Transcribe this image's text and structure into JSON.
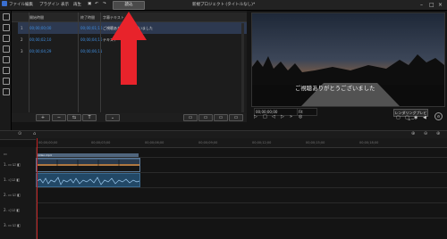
{
  "menu": [
    "ファイル",
    "編集",
    "プラグイン",
    "表示",
    "再生"
  ],
  "import_label": "読込",
  "window_title": "新規プロジェクト (タイトルなし)*",
  "subtitles": {
    "headers": [
      "開始時間",
      "終了時間",
      "字幕テキスト"
    ],
    "rows": [
      {
        "index": "1",
        "start": "00;00;00;00",
        "end": "00;00;01;10",
        "text": "ご視聴ありがとうございました"
      },
      {
        "index": "2",
        "start": "00;00;02;10",
        "end": "00;00;04;16",
        "text": "テキスト"
      },
      {
        "index": "3",
        "start": "00;00;04;29",
        "end": "00;00;06;11",
        "text": ""
      }
    ]
  },
  "preview": {
    "caption": "ご視聴ありがとうございました",
    "timecode": "00;00;00;00",
    "fit": "Fit",
    "render_label": "レンダリングプレビュー"
  },
  "timeline": {
    "ticks": [
      "00;00;00;00",
      "00;00;03;00",
      "00;00;06;00",
      "00;00;09;00",
      "00;00;12;00",
      "00;00;15;00",
      "00;00;18;00"
    ],
    "tracks": [
      "1.",
      "1.",
      "2.",
      "2.",
      "3."
    ],
    "clip_label": "video.mp4"
  },
  "colors": {
    "accent": "#3f8dde",
    "playhead": "#c02020",
    "arrow": "#e8232b"
  }
}
